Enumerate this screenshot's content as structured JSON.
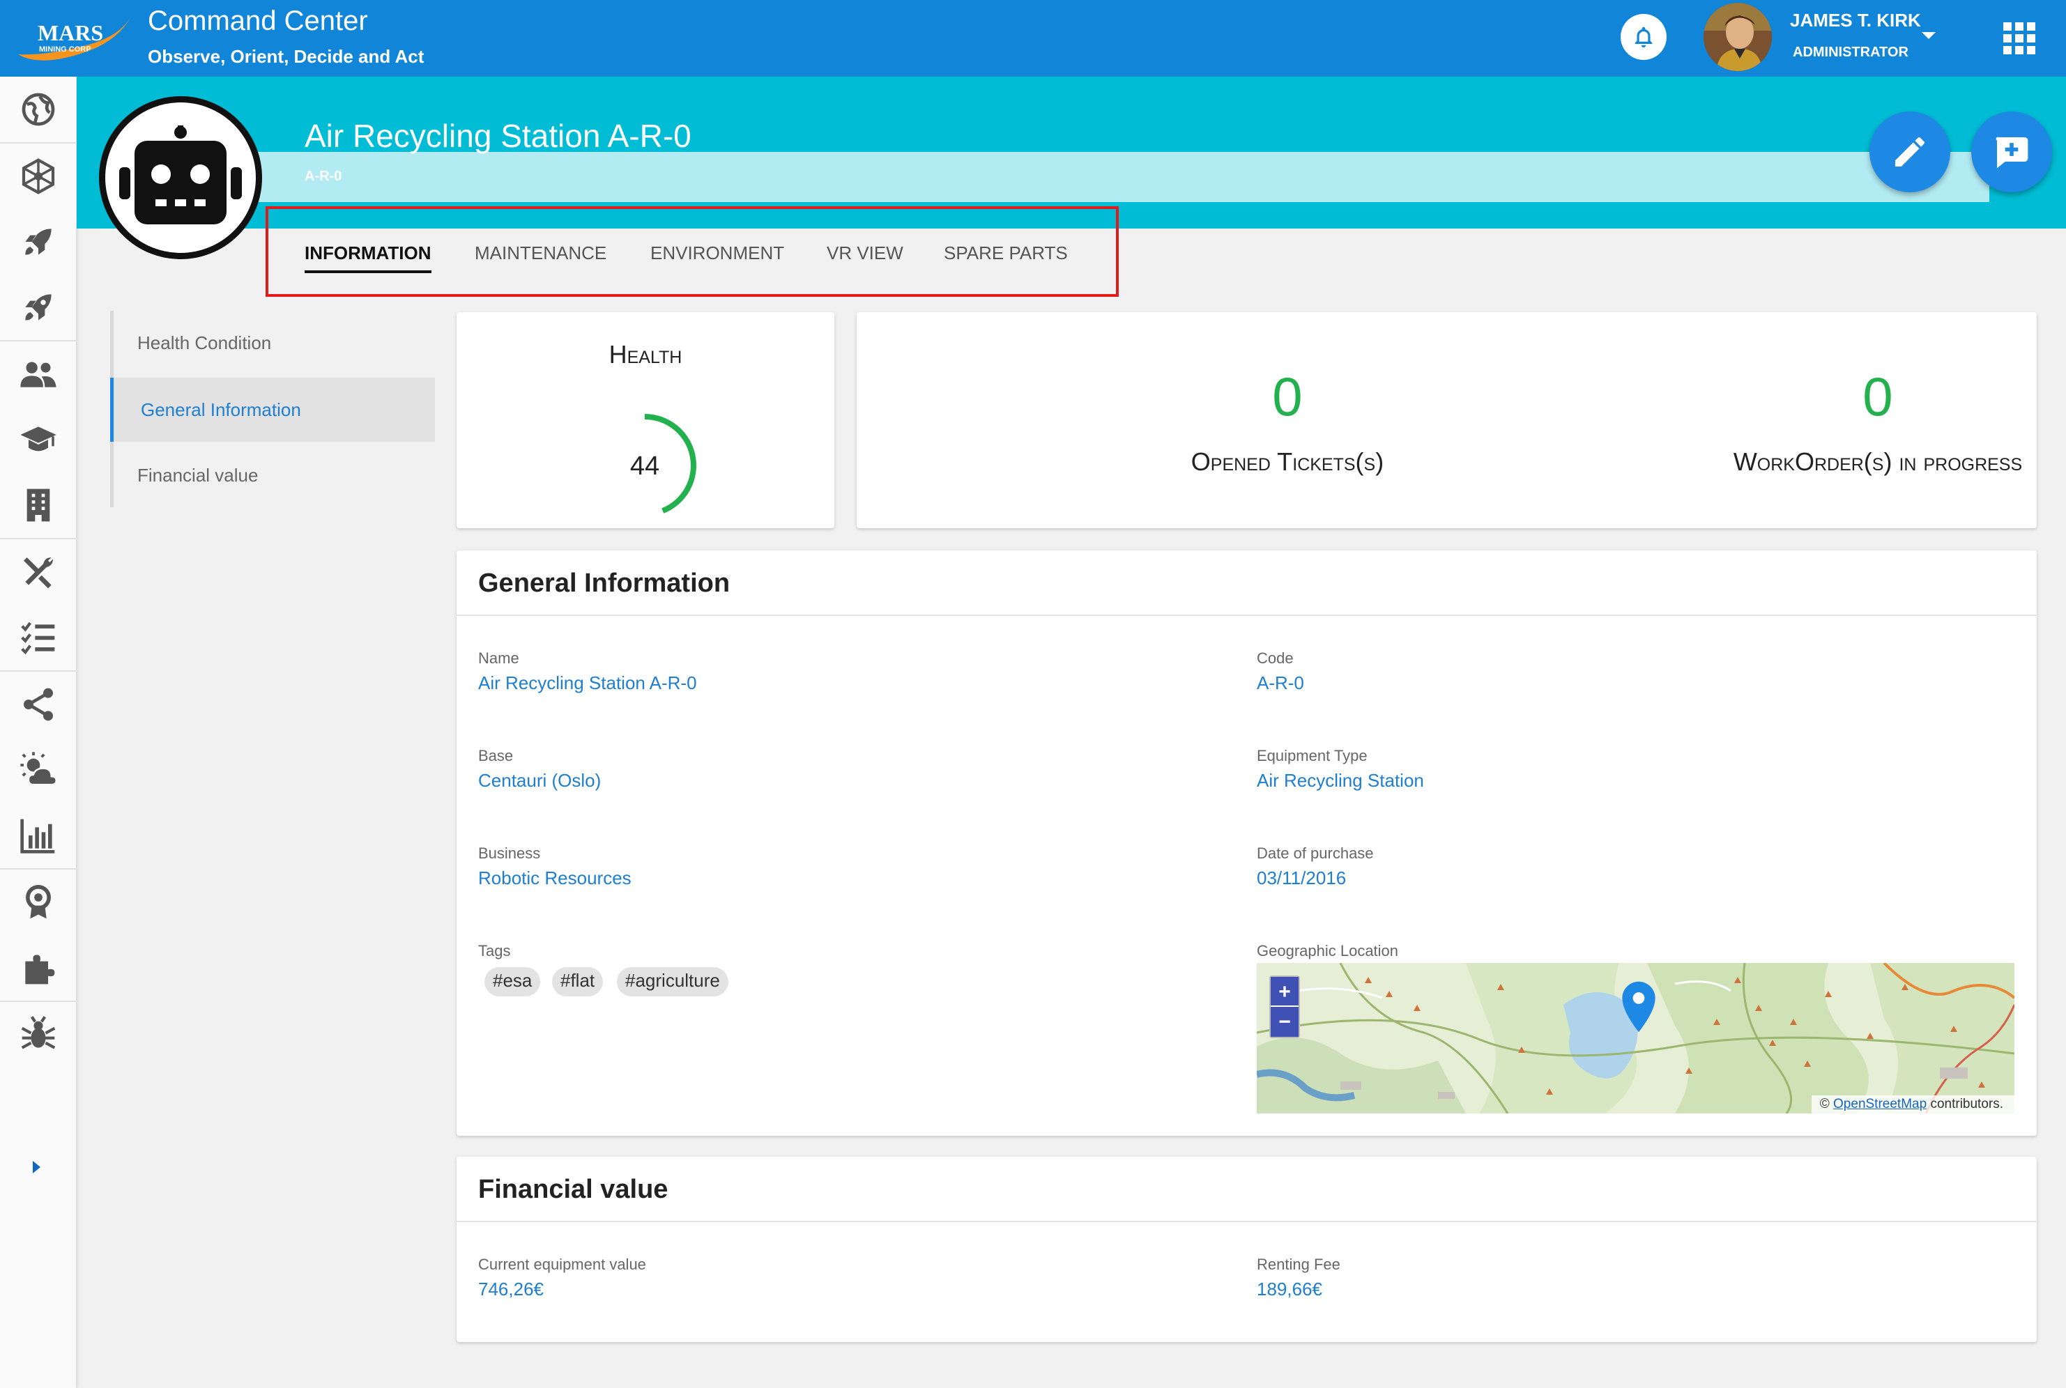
{
  "header": {
    "logo_text": "MARS",
    "logo_sub": "MINING CORP",
    "title": "Command Center",
    "subtitle": "Observe, Orient, Decide and Act",
    "user_name": "JAMES T. KIRK",
    "user_role": "ADMINISTRATOR",
    "icons": [
      "bell-icon",
      "avatar",
      "chevron-down-icon",
      "apps-grid-icon"
    ]
  },
  "rail": {
    "icons": [
      "globe-icon",
      "network-icon",
      "rocket-icon",
      "rocket-alt-icon",
      "people-icon",
      "graduation-cap-icon",
      "building-icon",
      "tools-icon",
      "checklist-icon",
      "share-icon",
      "weather-icon",
      "bar-chart-icon",
      "award-icon",
      "puzzle-icon",
      "bug-icon",
      "chevron-right-icon"
    ]
  },
  "equipment": {
    "title": "Air Recycling Station A-R-0",
    "code": "A-R-0",
    "icon": "robot-icon"
  },
  "tabs": [
    {
      "label": "INFORMATION",
      "active": true
    },
    {
      "label": "MAINTENANCE",
      "active": false
    },
    {
      "label": "ENVIRONMENT",
      "active": false
    },
    {
      "label": "VR VIEW",
      "active": false
    },
    {
      "label": "SPARE PARTS",
      "active": false
    }
  ],
  "side_nav": [
    {
      "label": "Health Condition",
      "active": false
    },
    {
      "label": "General Information",
      "active": true
    },
    {
      "label": "Financial value",
      "active": false
    }
  ],
  "health": {
    "title": "Health",
    "value": "44",
    "fraction": 0.44,
    "color": "#22b14c"
  },
  "stats": {
    "opened_tickets": {
      "value": "0",
      "label": "Opened Tickets(s)"
    },
    "workorders": {
      "value": "0",
      "label": "WorkOrder(s) in progress"
    }
  },
  "general_info": {
    "title": "General Information",
    "name": {
      "label": "Name",
      "value": "Air Recycling Station A-R-0"
    },
    "code": {
      "label": "Code",
      "value": "A-R-0"
    },
    "base": {
      "label": "Base",
      "value": "Centauri (Oslo)"
    },
    "equipment_type": {
      "label": "Equipment Type",
      "value": "Air Recycling Station"
    },
    "business": {
      "label": "Business",
      "value": "Robotic Resources"
    },
    "date_of_purchase": {
      "label": "Date of purchase",
      "value": "03/11/2016"
    },
    "tags": {
      "label": "Tags",
      "values": [
        "#esa",
        "#flat",
        "#agriculture"
      ]
    },
    "geo": {
      "label": "Geographic Location",
      "zoom_in": "+",
      "zoom_out": "−",
      "attribution_prefix": "©",
      "attribution_link": "OpenStreetMap",
      "attribution_suffix": "contributors."
    }
  },
  "financial": {
    "title": "Financial value",
    "current_value": {
      "label": "Current equipment value",
      "value": "746,26€"
    },
    "renting_fee": {
      "label": "Renting Fee",
      "value": "189,66€"
    }
  },
  "colors": {
    "topbar": "#1186d9",
    "hero": "#00bcd4",
    "tabstrip": "#b2ebf2",
    "accent": "#1e88e5",
    "link": "#1e7fd1",
    "success": "#22b14c",
    "highlight": "#e01b1b"
  }
}
